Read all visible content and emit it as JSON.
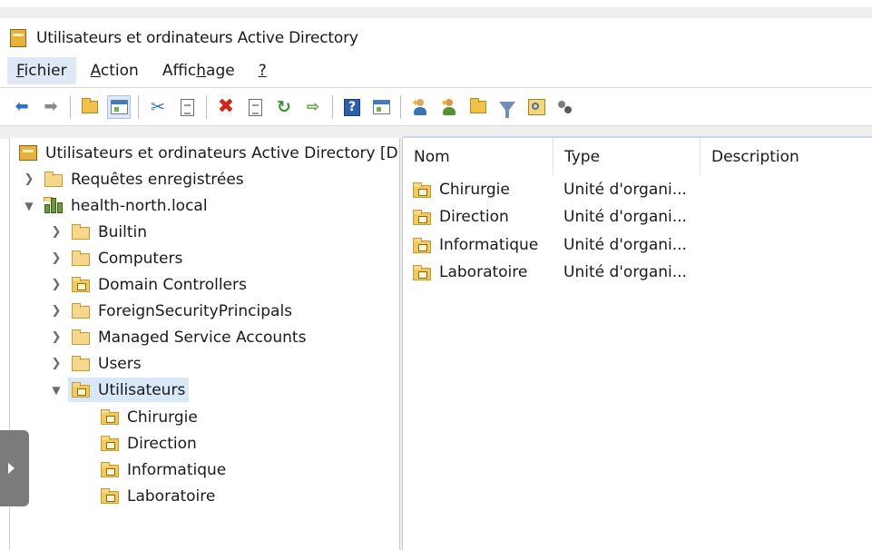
{
  "window": {
    "title": "Utilisateurs et ordinateurs Active Directory"
  },
  "menu": {
    "items": [
      {
        "label": "Fichier",
        "hotkey_index": 0
      },
      {
        "label": "Action",
        "hotkey_index": 0
      },
      {
        "label": "Affichage",
        "hotkey_index": 5
      },
      {
        "label": "?",
        "hotkey_index": 0
      }
    ]
  },
  "toolbar": {
    "icons": [
      "back-arrow-icon",
      "forward-arrow-icon",
      "up-folder-icon",
      "show-console-tree-icon",
      "cut-icon",
      "copy-icon",
      "delete-icon",
      "properties-icon",
      "refresh-icon",
      "export-list-icon",
      "help-icon",
      "show-action-pane-icon",
      "new-user-icon",
      "new-group-icon",
      "new-ou-icon",
      "filter-icon",
      "find-icon",
      "add-to-group-icon"
    ]
  },
  "tree": {
    "root": {
      "label": "Utilisateurs et ordinateurs Active Directory [D("
    },
    "saved_queries": {
      "label": "Requêtes enregistrées"
    },
    "domain": {
      "label": "health-north.local"
    },
    "children": [
      {
        "label": "Builtin",
        "type": "container"
      },
      {
        "label": "Computers",
        "type": "container"
      },
      {
        "label": "Domain Controllers",
        "type": "ou"
      },
      {
        "label": "ForeignSecurityPrincipals",
        "type": "container"
      },
      {
        "label": "Managed Service Accounts",
        "type": "container"
      },
      {
        "label": "Users",
        "type": "container"
      },
      {
        "label": "Utilisateurs",
        "type": "ou",
        "expanded": true,
        "selected": true
      }
    ],
    "ou_children": [
      {
        "label": "Chirurgie"
      },
      {
        "label": "Direction"
      },
      {
        "label": "Informatique"
      },
      {
        "label": "Laboratoire"
      }
    ]
  },
  "list": {
    "columns": [
      {
        "label": "Nom"
      },
      {
        "label": "Type"
      },
      {
        "label": "Description"
      }
    ],
    "rows": [
      {
        "name": "Chirurgie",
        "type": "Unité d'organi...",
        "description": ""
      },
      {
        "name": "Direction",
        "type": "Unité d'organi...",
        "description": ""
      },
      {
        "name": "Informatique",
        "type": "Unité d'organi...",
        "description": ""
      },
      {
        "name": "Laboratoire",
        "type": "Unité d'organi...",
        "description": ""
      }
    ]
  },
  "colors": {
    "selection": "#d9e8f8",
    "folder": "#f7d78b",
    "accent": "#2a72c8"
  }
}
